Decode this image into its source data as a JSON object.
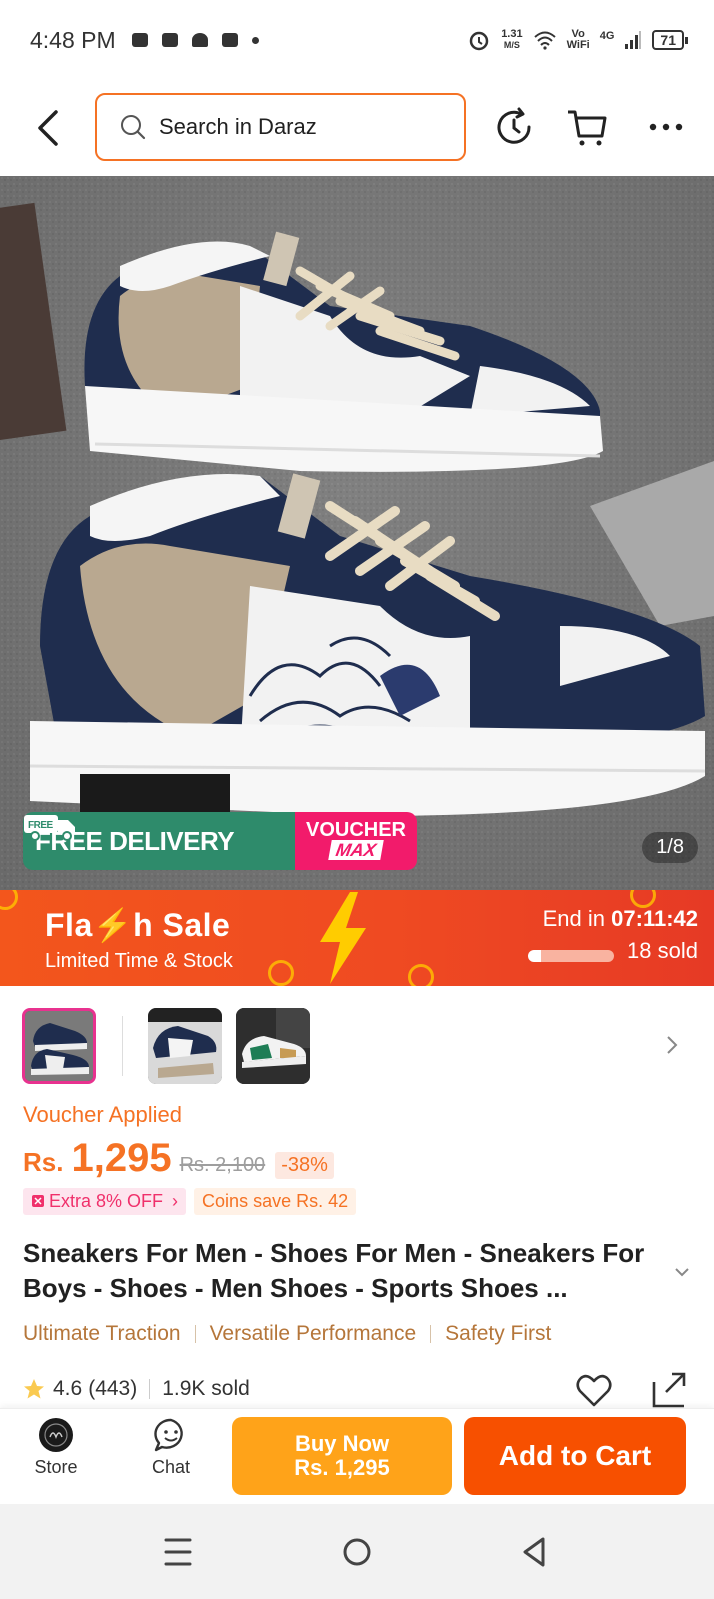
{
  "status_bar": {
    "time": "4:48 PM",
    "speed_value": "1.31",
    "speed_unit": "M/S",
    "network_top": "Vo",
    "network_bottom": "WiFi",
    "cell": "4G",
    "battery": "71"
  },
  "header": {
    "search_placeholder": "Search in Daraz",
    "icons": [
      "back-icon",
      "search-icon",
      "history-icon",
      "cart-icon",
      "more-icon"
    ]
  },
  "hero": {
    "badge_free_delivery": "FREE DELIVERY",
    "badge_free_truck_text": "FREE",
    "badge_voucher_top": "VOUCHER",
    "badge_voucher_bottom": "MAX",
    "image_counter": "1/8"
  },
  "flash_sale": {
    "title": "Fla⚡h Sale",
    "subtitle": "Limited Time & Stock",
    "end_label": "End in",
    "end_time": "07:11:42",
    "sold": "18 sold",
    "sold_progress": 0.15
  },
  "product": {
    "voucher_applied": "Voucher Applied",
    "currency": "Rs.",
    "price": "1,295",
    "original_price": "Rs. 2,100",
    "discount": "-38%",
    "extra_off": "Extra 8% OFF",
    "coins_save": "Coins save Rs. 42",
    "title": "Sneakers For Men - Shoes For Men - Sneakers For Boys - Shoes - Men Shoes - Sports Shoes ...",
    "features": [
      "Ultimate Traction",
      "Versatile Performance",
      "Safety First"
    ],
    "rating": "4.6",
    "reviews": "(443)",
    "sold": "1.9K sold"
  },
  "action_bar": {
    "store_label": "Store",
    "chat_label": "Chat",
    "buy_now_line1": "Buy Now",
    "buy_now_line2": "Rs. 1,295",
    "add_to_cart": "Add to Cart"
  },
  "colors": {
    "accent": "#f57224",
    "buy_now": "#ffa319",
    "add_to_cart": "#f75000",
    "free_delivery": "#2e8b6b",
    "voucher": "#f21b6b"
  }
}
